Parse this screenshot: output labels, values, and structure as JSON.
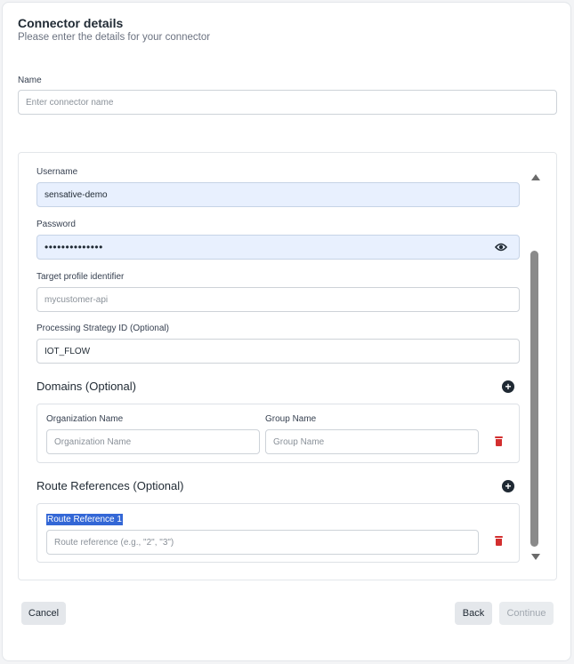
{
  "header": {
    "title": "Connector details",
    "subtitle": "Please enter the details for your connector"
  },
  "name_field": {
    "label": "Name",
    "placeholder": "Enter connector name"
  },
  "credentials": {
    "username_label": "Username",
    "username_value": "sensative-demo",
    "password_label": "Password",
    "password_value": "••••••••••••••",
    "target_label": "Target profile identifier",
    "target_placeholder": "mycustomer-api",
    "strategy_label": "Processing Strategy ID (Optional)",
    "strategy_value": "IOT_FLOW"
  },
  "domains": {
    "title": "Domains (Optional)",
    "org_label": "Organization Name",
    "org_placeholder": "Organization Name",
    "group_label": "Group Name",
    "group_placeholder": "Group Name"
  },
  "routes": {
    "title": "Route References (Optional)",
    "item_label": "Route Reference 1",
    "item_placeholder": "Route reference (e.g., \"2\", \"3\")"
  },
  "footer": {
    "cancel_label": "Cancel",
    "back_label": "Back",
    "continue_label": "Continue"
  },
  "colors": {
    "accent": "#3367d6",
    "danger": "#d32f2f",
    "autofill": "#e8f0fe"
  }
}
